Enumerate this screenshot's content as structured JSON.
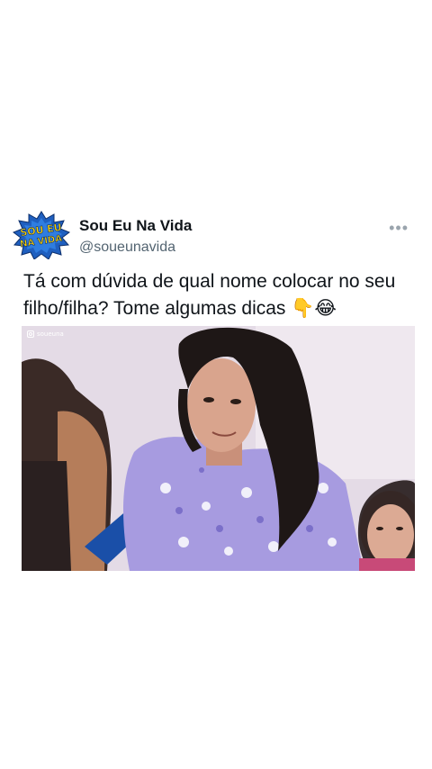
{
  "tweet": {
    "author": {
      "display_name": "Sou Eu Na Vida",
      "handle": "@soueunavida",
      "avatar_text_line1": "SOU EU",
      "avatar_text_line2": "NA VIDA"
    },
    "more_label": "•••",
    "text": "Tá com dúvida de qual nome colocar no seu filho/filha? Tome algumas dicas 👇😂",
    "media": {
      "watermark": "soueuna"
    }
  },
  "colors": {
    "background": "#ffffff",
    "text": "#0f1419",
    "secondary_text": "#536471",
    "avatar_blue": "#1f5fbf",
    "avatar_yellow": "#ffd400"
  }
}
